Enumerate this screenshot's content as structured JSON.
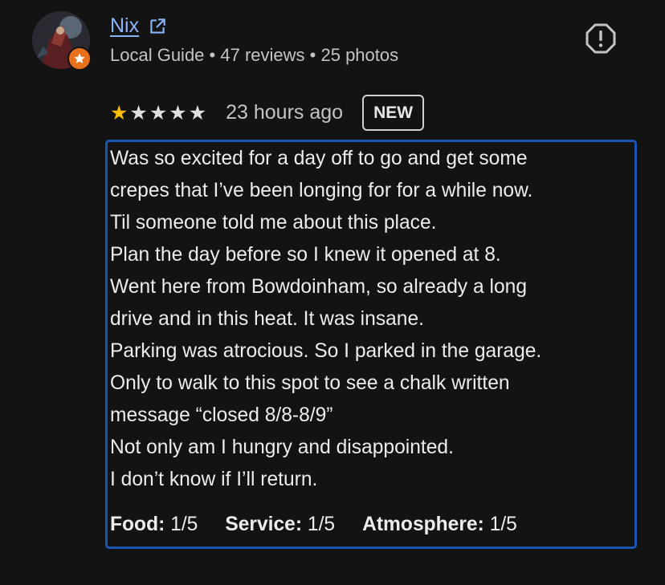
{
  "reviewer": {
    "name": "Nix",
    "local_guide": "Local Guide",
    "reviews": "47 reviews",
    "photos": "25 photos",
    "separator": "•"
  },
  "rating": {
    "stars_filled": 1,
    "stars_total": 5,
    "time_ago": "23 hours ago",
    "badge": "NEW"
  },
  "review_lines": [
    "Was so excited for a day off to go and get some",
    "crepes that I’ve been longing for for a while now.",
    "Til someone told me about this place.",
    "Plan the day before so I knew it opened at 8.",
    "Went here from Bowdoinham, so already a long",
    "drive and in this heat. It was insane.",
    "Parking was atrocious. So I parked in the garage.",
    "Only to walk to this spot to see a chalk written",
    "message “closed 8/8-8/9”",
    "Not only am I hungry and disappointed.",
    "I don’t know if I’ll return."
  ],
  "sub_ratings": [
    {
      "label": "Food:",
      "value": "1/5"
    },
    {
      "label": "Service:",
      "value": "1/5"
    },
    {
      "label": "Atmosphere:",
      "value": "1/5"
    }
  ],
  "icons": {
    "external": "open-in-new-icon",
    "report": "report-flag-icon",
    "guide": "local-guide-star-icon"
  },
  "colors": {
    "background": "#131313",
    "link": "#8ab4f8",
    "star_filled": "#fbbc04",
    "guide_badge": "#e8711c",
    "highlight_border": "#1d55b3"
  }
}
